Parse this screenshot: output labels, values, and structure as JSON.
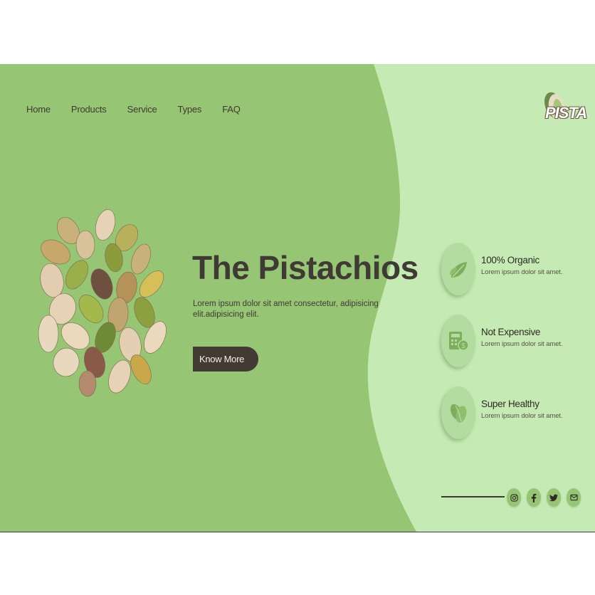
{
  "nav": {
    "items": [
      "Home",
      "Products",
      "Service",
      "Types",
      "FAQ"
    ]
  },
  "logo": {
    "text": "PISTA"
  },
  "hero": {
    "title": "The Pistachios",
    "description": "Lorem ipsum dolor sit amet consectetur, adipisicing elit.adipisicing elit.",
    "cta_label": "Know More"
  },
  "features": [
    {
      "title": "100% Organic",
      "text": "Lorem ipsum dolor sit amet.",
      "icon": "leaf-icon"
    },
    {
      "title": "Not Expensive",
      "text": "Lorem ipsum dolor sit amet.",
      "icon": "calculator-money-icon"
    },
    {
      "title": "Super Healthy",
      "text": "Lorem ipsum dolor sit amet.",
      "icon": "pistachio-icon"
    }
  ],
  "social": [
    "instagram-icon",
    "facebook-icon",
    "twitter-icon",
    "email-icon"
  ],
  "colors": {
    "primary_green": "#96c574",
    "light_green": "#c5eab3",
    "icon_circle": "#b3dca0",
    "dark_brown": "#433a33",
    "text": "#3f3a34"
  }
}
